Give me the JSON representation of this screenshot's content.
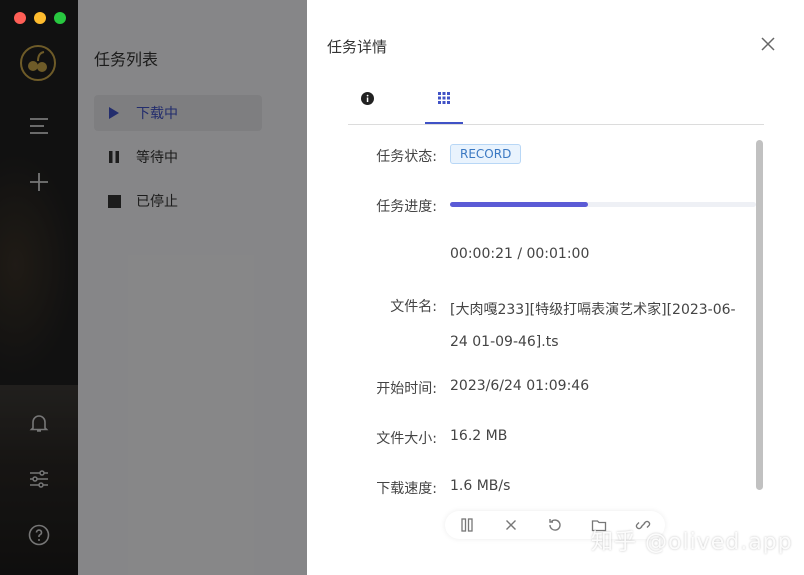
{
  "task_list": {
    "title": "任务列表",
    "items": [
      {
        "label": "下载中",
        "icon": "play-icon"
      },
      {
        "label": "等待中",
        "icon": "pause-icon"
      },
      {
        "label": "已停止",
        "icon": "stop-icon"
      }
    ]
  },
  "drawer": {
    "title": "任务详情",
    "tabs": [
      {
        "icon": "info-icon"
      },
      {
        "icon": "grid-icon"
      }
    ],
    "fields": {
      "status_label": "任务状态:",
      "status_value": "RECORD",
      "progress_label": "任务进度:",
      "progress_fraction": 0.45,
      "time_text": "00:00:21 / 00:01:00",
      "filename_label": "文件名:",
      "filename_value": "[大肉嘎233][特级打嗝表演艺术家][2023-06-24 01-09-46].ts",
      "start_label": "开始时间:",
      "start_value": "2023/6/24 01:09:46",
      "size_label": "文件大小:",
      "size_value": "16.2 MB",
      "speed_label": "下载速度:",
      "speed_value": "1.6 MB/s"
    }
  },
  "actions": [
    "pause-icon",
    "cancel-icon",
    "retry-icon",
    "folder-icon",
    "link-icon"
  ],
  "watermark": "知乎 @olived.app",
  "colors": {
    "accent": "#4052c6",
    "progress": "#5b5bd6",
    "badge_text": "#3a78c2"
  }
}
